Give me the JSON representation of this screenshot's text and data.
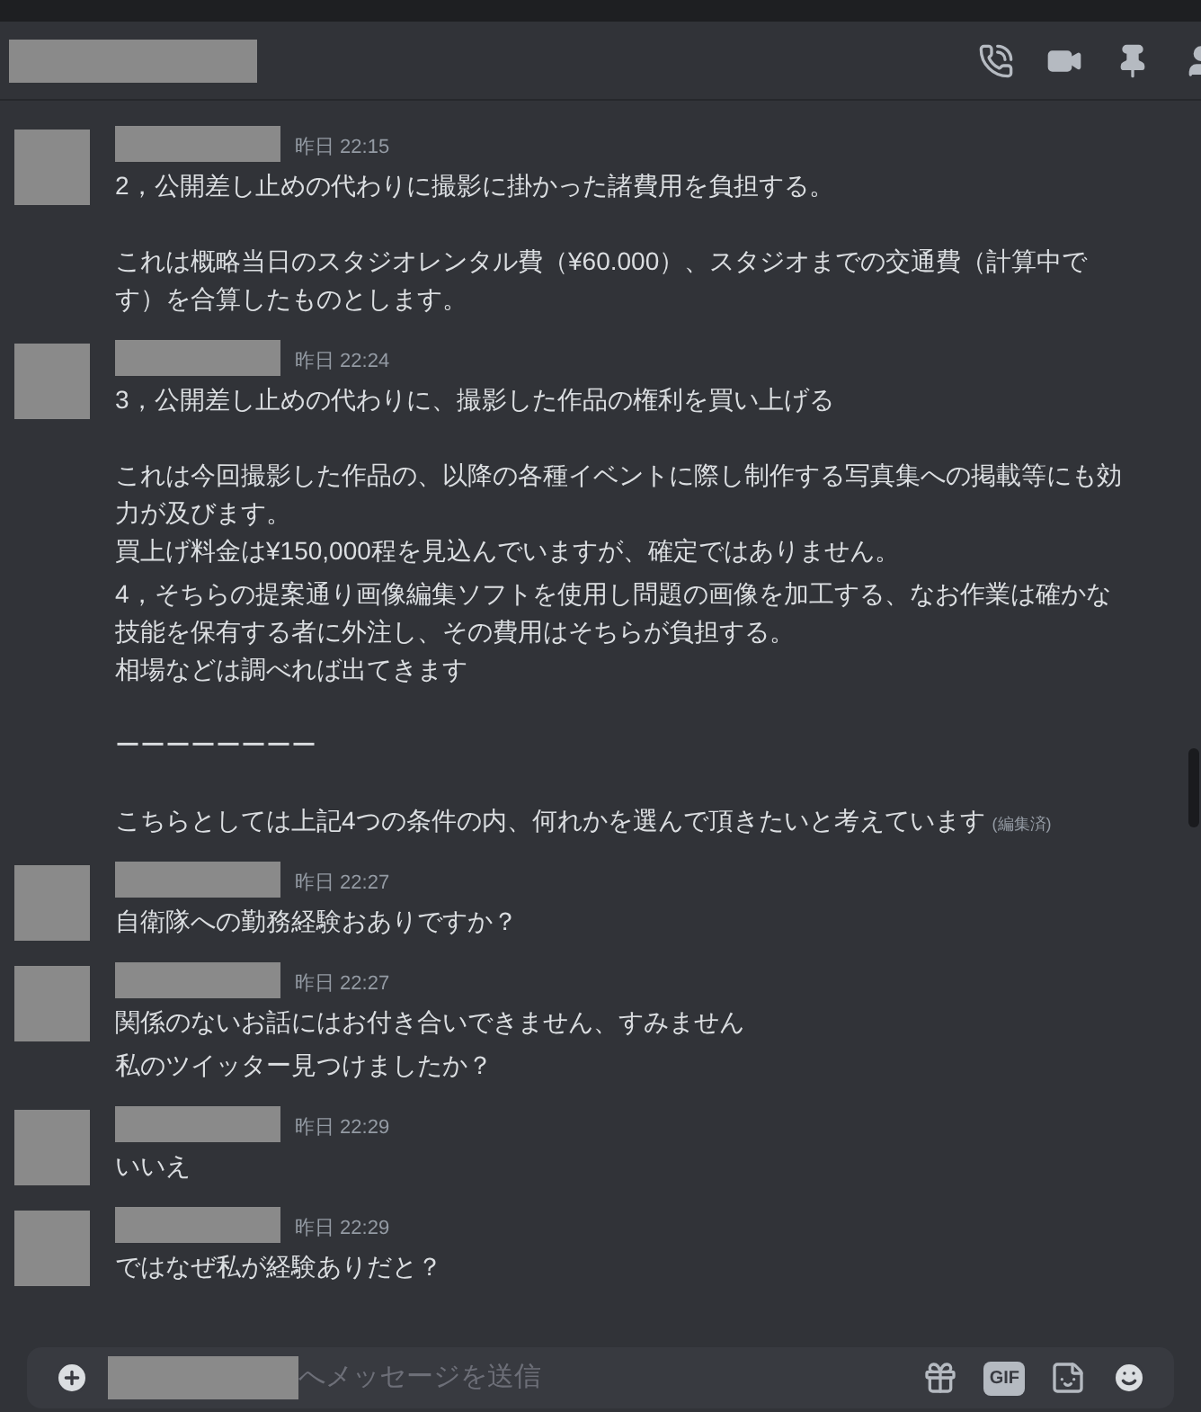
{
  "messages": [
    {
      "time": "昨日 22:15",
      "parts": [
        {
          "blocks": [
            [
              "2，公開差し止めの代わりに撮影に掛かった諸費用を負担する。"
            ],
            [
              "これは概略当日のスタジオレンタル費（¥60.000）、スタジオまでの交通費（計算中です）を合算したものとします。"
            ]
          ]
        }
      ]
    },
    {
      "time": "昨日 22:24",
      "parts": [
        {
          "blocks": [
            [
              "3，公開差し止めの代わりに、撮影した作品の権利を買い上げる"
            ],
            [
              "これは今回撮影した作品の、以降の各種イベントに際し制作する写真集への掲載等にも効力が及びます。",
              "買上げ料金は¥150,000程を見込んでいますが、確定ではありません。"
            ]
          ]
        },
        {
          "blocks": [
            [
              "4，そちらの提案通り画像編集ソフトを使用し問題の画像を加工する、なお作業は確かな技能を保有する者に外注し、その費用はそちらが負担する。",
              "相場などは調べれば出てきます"
            ],
            [
              "ーーーーーーーー"
            ],
            [
              "こちらとしては上記4つの条件の内、何れかを選んで頂きたいと考えています"
            ]
          ],
          "edited": "(編集済)"
        }
      ]
    },
    {
      "time": "昨日 22:27",
      "parts": [
        {
          "blocks": [
            [
              "自衛隊への勤務経験おありですか？"
            ]
          ]
        }
      ]
    },
    {
      "time": "昨日 22:27",
      "parts": [
        {
          "blocks": [
            [
              "関係のないお話にはお付き合いできません、すみません"
            ]
          ]
        },
        {
          "blocks": [
            [
              "私のツイッター見つけましたか？"
            ]
          ]
        }
      ]
    },
    {
      "time": "昨日 22:29",
      "parts": [
        {
          "blocks": [
            [
              "いいえ"
            ]
          ]
        }
      ]
    },
    {
      "time": "昨日 22:29",
      "parts": [
        {
          "blocks": [
            [
              "ではなぜ私が経験ありだと？"
            ]
          ]
        }
      ]
    }
  ],
  "composer": {
    "placeholder": "へメッセージを送信",
    "gif_label": "GIF"
  }
}
